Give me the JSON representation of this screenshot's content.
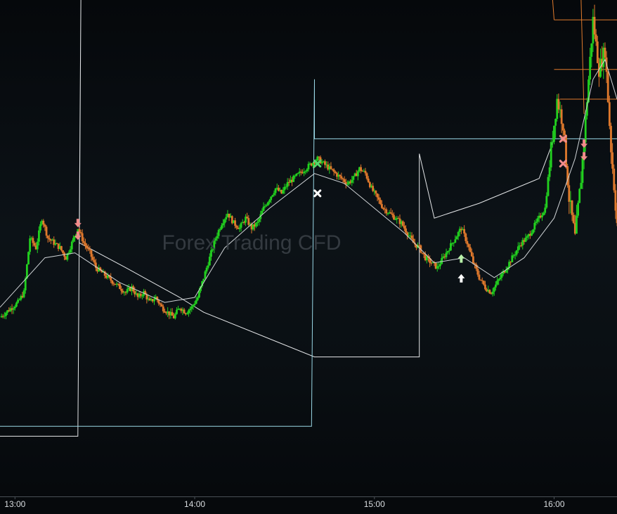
{
  "chart_data": {
    "type": "candlestick",
    "watermark": "Forex Trading CFD",
    "x_axis": {
      "tick_labels": [
        "13:00",
        "14:00",
        "15:00",
        "16:00"
      ],
      "tick_minutes": [
        0,
        60,
        120,
        180
      ],
      "range_minutes": [
        -5,
        201
      ]
    },
    "y_axis": {
      "range": [
        0,
        100
      ]
    },
    "colors": {
      "up": "#22d11f",
      "down": "#e0792c",
      "ma": "#cfd3d6",
      "channel_white": "#e5e7e9",
      "channel_cyan": "#9ad8e6",
      "channel_orange": "#e07a2c",
      "sell_arrow": "#f28b8b",
      "buy_arrow": "#b8f0a8",
      "close_mark": "#f28b8b",
      "white_mark": "#ffffff"
    },
    "close_anchors": [
      [
        -5,
        36
      ],
      [
        -3,
        37
      ],
      [
        -1,
        38
      ],
      [
        1,
        39
      ],
      [
        3,
        41
      ],
      [
        5,
        52
      ],
      [
        7,
        50
      ],
      [
        9,
        56
      ],
      [
        11,
        52
      ],
      [
        13,
        51
      ],
      [
        15,
        50
      ],
      [
        17,
        48
      ],
      [
        19,
        51
      ],
      [
        21,
        54
      ],
      [
        23,
        51
      ],
      [
        25,
        49
      ],
      [
        27,
        46
      ],
      [
        29,
        45
      ],
      [
        31,
        44
      ],
      [
        33,
        43
      ],
      [
        35,
        42
      ],
      [
        37,
        41
      ],
      [
        39,
        42
      ],
      [
        41,
        40
      ],
      [
        43,
        41
      ],
      [
        45,
        39
      ],
      [
        47,
        40
      ],
      [
        49,
        38
      ],
      [
        51,
        37
      ],
      [
        53,
        36
      ],
      [
        55,
        38
      ],
      [
        57,
        37
      ],
      [
        59,
        38
      ],
      [
        61,
        40
      ],
      [
        63,
        44
      ],
      [
        65,
        48
      ],
      [
        67,
        52
      ],
      [
        69,
        55
      ],
      [
        71,
        57
      ],
      [
        73,
        55
      ],
      [
        75,
        54
      ],
      [
        77,
        56
      ],
      [
        79,
        54
      ],
      [
        81,
        55
      ],
      [
        83,
        58
      ],
      [
        85,
        60
      ],
      [
        87,
        62
      ],
      [
        89,
        61
      ],
      [
        91,
        63
      ],
      [
        93,
        64
      ],
      [
        95,
        65
      ],
      [
        97,
        66
      ],
      [
        99,
        67
      ],
      [
        101,
        68
      ],
      [
        103,
        67
      ],
      [
        105,
        66
      ],
      [
        107,
        65
      ],
      [
        109,
        64
      ],
      [
        111,
        63
      ],
      [
        113,
        64
      ],
      [
        115,
        66
      ],
      [
        117,
        65
      ],
      [
        119,
        62
      ],
      [
        121,
        60
      ],
      [
        123,
        58
      ],
      [
        125,
        57
      ],
      [
        127,
        56
      ],
      [
        129,
        55
      ],
      [
        131,
        53
      ],
      [
        133,
        51
      ],
      [
        135,
        50
      ],
      [
        137,
        48
      ],
      [
        139,
        47
      ],
      [
        141,
        46
      ],
      [
        143,
        48
      ],
      [
        145,
        50
      ],
      [
        147,
        52
      ],
      [
        149,
        54
      ],
      [
        151,
        51
      ],
      [
        153,
        47
      ],
      [
        155,
        44
      ],
      [
        157,
        42
      ],
      [
        159,
        41
      ],
      [
        161,
        43
      ],
      [
        163,
        45
      ],
      [
        165,
        47
      ],
      [
        167,
        49
      ],
      [
        169,
        51
      ],
      [
        171,
        52
      ],
      [
        173,
        54
      ],
      [
        175,
        56
      ],
      [
        177,
        58
      ],
      [
        179,
        70
      ],
      [
        181,
        80
      ],
      [
        183,
        75
      ],
      [
        185,
        60
      ],
      [
        187,
        52
      ],
      [
        189,
        64
      ],
      [
        191,
        80
      ],
      [
        193,
        96
      ],
      [
        195,
        86
      ],
      [
        197,
        90
      ],
      [
        199,
        70
      ],
      [
        201,
        55
      ]
    ],
    "moving_average_points": [
      [
        -5,
        38
      ],
      [
        10,
        48
      ],
      [
        20,
        49
      ],
      [
        35,
        43
      ],
      [
        50,
        39
      ],
      [
        60,
        40
      ],
      [
        70,
        50
      ],
      [
        85,
        58
      ],
      [
        100,
        65
      ],
      [
        110,
        63
      ],
      [
        120,
        58
      ],
      [
        130,
        53
      ],
      [
        140,
        47
      ],
      [
        150,
        48
      ],
      [
        160,
        44
      ],
      [
        170,
        48
      ],
      [
        180,
        56
      ],
      [
        187,
        68
      ],
      [
        193,
        84
      ],
      [
        197,
        88
      ],
      [
        201,
        80
      ]
    ],
    "channel_white": [
      [
        -5,
        12
      ],
      [
        21,
        12
      ],
      [
        22,
        100
      ],
      [
        21.5,
        51
      ],
      [
        37,
        46
      ],
      [
        55,
        40
      ],
      [
        63,
        37
      ],
      [
        100,
        28
      ],
      [
        135,
        28
      ],
      [
        135,
        69
      ],
      [
        140,
        56
      ],
      [
        155,
        59
      ],
      [
        175,
        64
      ],
      [
        180,
        72
      ]
    ],
    "channel_cyan": [
      [
        -5,
        14
      ],
      [
        99,
        14
      ],
      [
        100,
        84
      ],
      [
        100,
        72
      ],
      [
        180,
        72
      ],
      [
        201,
        72
      ]
    ],
    "channel_orange": [
      [
        179.5,
        100
      ],
      [
        180,
        96
      ],
      [
        180,
        96
      ],
      [
        201,
        96
      ],
      [
        180,
        86
      ],
      [
        201,
        86
      ],
      [
        182,
        80
      ],
      [
        201,
        80
      ],
      [
        189,
        100
      ],
      [
        190,
        77
      ]
    ],
    "markers": [
      {
        "kind": "sell_arrow",
        "minute": 21,
        "value": 56,
        "count": 2
      },
      {
        "kind": "close_x_green",
        "minute": 101,
        "value": 67
      },
      {
        "kind": "close_x_white",
        "minute": 101,
        "value": 61
      },
      {
        "kind": "buy_arrow_green",
        "minute": 149,
        "value": 48
      },
      {
        "kind": "buy_arrow_white",
        "minute": 149,
        "value": 44
      },
      {
        "kind": "close_x_red",
        "minute": 183,
        "value": 72
      },
      {
        "kind": "close_x_red",
        "minute": 183,
        "value": 67
      },
      {
        "kind": "sell_arrow",
        "minute": 190,
        "value": 72,
        "count": 2
      }
    ]
  }
}
